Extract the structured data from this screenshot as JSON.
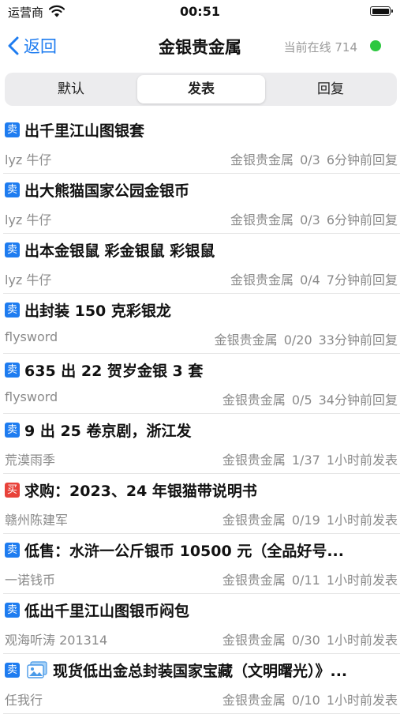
{
  "status_bar": {
    "carrier": "运营商",
    "time": "00:51"
  },
  "nav": {
    "back_label": "返回",
    "title": "金银贵金属",
    "online": "当前在线 714"
  },
  "tabs": [
    {
      "label": "默认",
      "active": false
    },
    {
      "label": "发表",
      "active": true
    },
    {
      "label": "回复",
      "active": false
    }
  ],
  "colors": {
    "accent": "#1e7cf0",
    "sell_badge": "#1e7cf0",
    "buy_badge": "#e8423a",
    "online_dot": "#2dc840"
  },
  "posts": [
    {
      "badge": "卖",
      "badge_type": "sell",
      "title": "出千里江山图银套",
      "author": "lyz 牛仔",
      "forum": "金银贵金属",
      "counts": "0/3",
      "time": "6分钟前回复"
    },
    {
      "badge": "卖",
      "badge_type": "sell",
      "title": "出大熊猫国家公园金银币",
      "author": "lyz 牛仔",
      "forum": "金银贵金属",
      "counts": "0/3",
      "time": "6分钟前回复"
    },
    {
      "badge": "卖",
      "badge_type": "sell",
      "title": "出本金银鼠 彩金银鼠 彩银鼠",
      "author": "lyz 牛仔",
      "forum": "金银贵金属",
      "counts": "0/4",
      "time": "7分钟前回复"
    },
    {
      "badge": "卖",
      "badge_type": "sell",
      "title": "出封装 150 克彩银龙",
      "author": "flysword",
      "forum": "金银贵金属",
      "counts": "0/20",
      "time": "33分钟前回复"
    },
    {
      "badge": "卖",
      "badge_type": "sell",
      "title": "635 出 22 贺岁金银 3 套",
      "author": "flysword",
      "forum": "金银贵金属",
      "counts": "0/5",
      "time": "34分钟前回复"
    },
    {
      "badge": "卖",
      "badge_type": "sell",
      "title": "9 出 25 卷京剧，浙江发",
      "author": "荒漠雨季",
      "forum": "金银贵金属",
      "counts": "1/37",
      "time": "1小时前发表"
    },
    {
      "badge": "买",
      "badge_type": "buy",
      "title": "求购：2023、24 年银猫带说明书",
      "author": "赣州陈建军",
      "forum": "金银贵金属",
      "counts": "0/19",
      "time": "1小时前发表"
    },
    {
      "badge": "卖",
      "badge_type": "sell",
      "title": "低售：水浒一公斤银币 10500 元（全品好号...",
      "author": "一诺钱币",
      "forum": "金银贵金属",
      "counts": "0/11",
      "time": "1小时前发表"
    },
    {
      "badge": "卖",
      "badge_type": "sell",
      "title": "低出千里江山图银币闷包",
      "author": "观海听涛 201314",
      "forum": "金银贵金属",
      "counts": "0/30",
      "time": "1小时前发表"
    },
    {
      "badge": "卖",
      "badge_type": "sell",
      "has_image": true,
      "image_icon": "image-icon",
      "title": "现货低出金总封装国家宝藏（文明曙光）》...",
      "author": "任我行",
      "forum": "金银贵金属",
      "counts": "0/10",
      "time": "1小时前发表"
    }
  ]
}
